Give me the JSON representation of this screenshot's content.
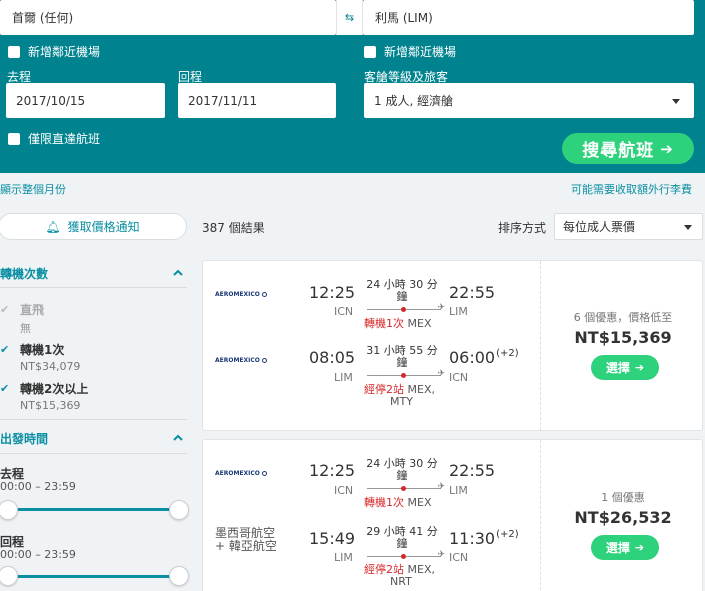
{
  "search": {
    "origin": "首爾 (任何)",
    "destination": "利馬 (LIM)",
    "add_nearby_origin": "新增鄰近機場",
    "add_nearby_dest": "新增鄰近機場",
    "depart_label": "去程",
    "return_label": "回程",
    "depart_date": "2017/10/15",
    "return_date": "2017/11/11",
    "cabin_label": "客艙等級及旅客",
    "cabin_value": "1 成人, 經濟艙",
    "direct_only": "僅限直達航班",
    "search_button": "搜尋航班",
    "search_arrow": "➔"
  },
  "toolbar": {
    "show_month": "顯示整個月份",
    "baggage_fee": "可能需要收取額外行李費",
    "price_alert": "獲取價格通知",
    "results_count": "387 個結果",
    "sort_label": "排序方式",
    "sort_value": "每位成人票價"
  },
  "filters": {
    "stops_title": "轉機次數",
    "stops": [
      {
        "name": "直飛",
        "sub": "無",
        "checked": true,
        "disabled": true
      },
      {
        "name": "轉機1次",
        "sub": "NT$34,079",
        "checked": true,
        "disabled": false
      },
      {
        "name": "轉機2次以上",
        "sub": "NT$15,369",
        "checked": true,
        "disabled": false
      }
    ],
    "time_title": "出發時間",
    "outbound_label": "去程",
    "outbound_range": "00:00 – 23:59",
    "return_label": "回程",
    "return_range": "00:00 – 23:59"
  },
  "results": [
    {
      "legs": [
        {
          "airline": "AEROMEXICO",
          "dep_time": "12:25",
          "dep_code": "ICN",
          "duration_1": "24 小時 30 分",
          "duration_2": "鐘",
          "arr_time": "22:55",
          "arr_plus": "",
          "arr_code": "LIM",
          "stops_red": "轉機1次",
          "stops_gray": " MEX",
          "stops_line2": ""
        },
        {
          "airline": "AEROMEXICO",
          "dep_time": "08:05",
          "dep_code": "LIM",
          "duration_1": "31 小時 55 分",
          "duration_2": "鐘",
          "arr_time": "06:00",
          "arr_plus": "(+2)",
          "arr_code": "ICN",
          "stops_red": "經停2站",
          "stops_gray": " MEX,",
          "stops_line2": "MTY"
        }
      ],
      "deals": "6 個優惠，價格低至",
      "price": "NT$15,369",
      "select": "選擇",
      "select_arrow": "➔"
    },
    {
      "legs": [
        {
          "airline": "AEROMEXICO",
          "dep_time": "12:25",
          "dep_code": "ICN",
          "duration_1": "24 小時 30 分",
          "duration_2": "鐘",
          "arr_time": "22:55",
          "arr_plus": "",
          "arr_code": "LIM",
          "stops_red": "轉機1次",
          "stops_gray": " MEX",
          "stops_line2": ""
        },
        {
          "airline_text_1": "墨西哥航空",
          "airline_text_2": "+ 韓亞航空",
          "dep_time": "15:49",
          "dep_code": "LIM",
          "duration_1": "29 小時 41 分",
          "duration_2": "鐘",
          "arr_time": "11:30",
          "arr_plus": "(+2)",
          "arr_code": "ICN",
          "stops_red": "經停2站",
          "stops_gray": " MEX,",
          "stops_line2": "NRT"
        }
      ],
      "deals": "1 個優惠",
      "price": "NT$26,532",
      "select": "選擇",
      "select_arrow": "➔"
    }
  ],
  "colors": {
    "panel": "#00838f",
    "accent": "#0a8fa2",
    "green": "#2ed27c",
    "red": "#d62828"
  }
}
